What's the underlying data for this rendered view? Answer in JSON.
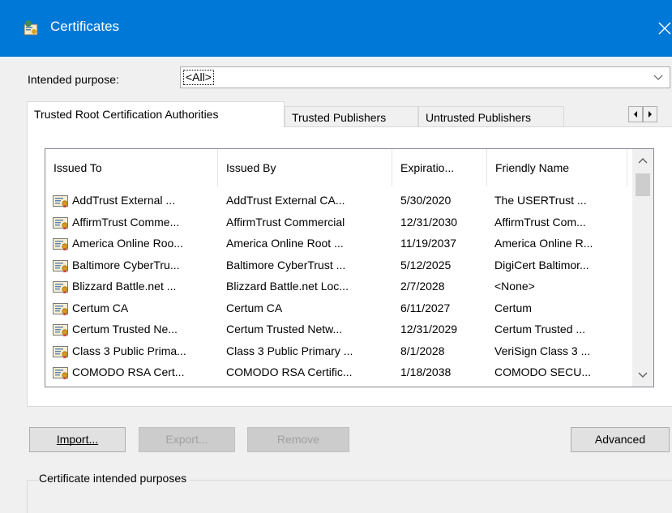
{
  "window": {
    "title": "Certificates",
    "close_icon": "close-icon"
  },
  "purpose": {
    "label": "Intended purpose:",
    "selected": "<All>"
  },
  "tabs": [
    {
      "label": "Trusted Root Certification Authorities",
      "active": true
    },
    {
      "label": "Trusted Publishers",
      "active": false
    },
    {
      "label": "Untrusted Publishers",
      "active": false
    }
  ],
  "list": {
    "columns": [
      "Issued To",
      "Issued By",
      "Expiratio...",
      "Friendly Name"
    ],
    "rows": [
      {
        "issued_to": "AddTrust External ...",
        "issued_by": "AddTrust External CA...",
        "expiration": "5/30/2020",
        "friendly": "The USERTrust ..."
      },
      {
        "issued_to": "AffirmTrust Comme...",
        "issued_by": "AffirmTrust Commercial",
        "expiration": "12/31/2030",
        "friendly": "AffirmTrust Com..."
      },
      {
        "issued_to": "America Online Roo...",
        "issued_by": "America Online Root ...",
        "expiration": "11/19/2037",
        "friendly": "America Online R..."
      },
      {
        "issued_to": "Baltimore CyberTru...",
        "issued_by": "Baltimore CyberTrust ...",
        "expiration": "5/12/2025",
        "friendly": "DigiCert Baltimor..."
      },
      {
        "issued_to": "Blizzard Battle.net ...",
        "issued_by": "Blizzard Battle.net Loc...",
        "expiration": "2/7/2028",
        "friendly": "<None>"
      },
      {
        "issued_to": "Certum CA",
        "issued_by": "Certum CA",
        "expiration": "6/11/2027",
        "friendly": "Certum"
      },
      {
        "issued_to": "Certum Trusted Ne...",
        "issued_by": "Certum Trusted Netw...",
        "expiration": "12/31/2029",
        "friendly": "Certum Trusted ..."
      },
      {
        "issued_to": "Class 3 Public Prima...",
        "issued_by": "Class 3 Public Primary ...",
        "expiration": "8/1/2028",
        "friendly": "VeriSign Class 3 ..."
      },
      {
        "issued_to": "COMODO RSA Cert...",
        "issued_by": "COMODO RSA Certific...",
        "expiration": "1/18/2038",
        "friendly": "COMODO SECU..."
      }
    ]
  },
  "buttons": {
    "import": "Import...",
    "export": "Export...",
    "remove": "Remove",
    "advanced": "Advanced"
  },
  "purposes_group": {
    "label": "Certificate intended purposes"
  },
  "colors": {
    "titlebar": "#0078d7",
    "focus_border": "#0078d7"
  }
}
